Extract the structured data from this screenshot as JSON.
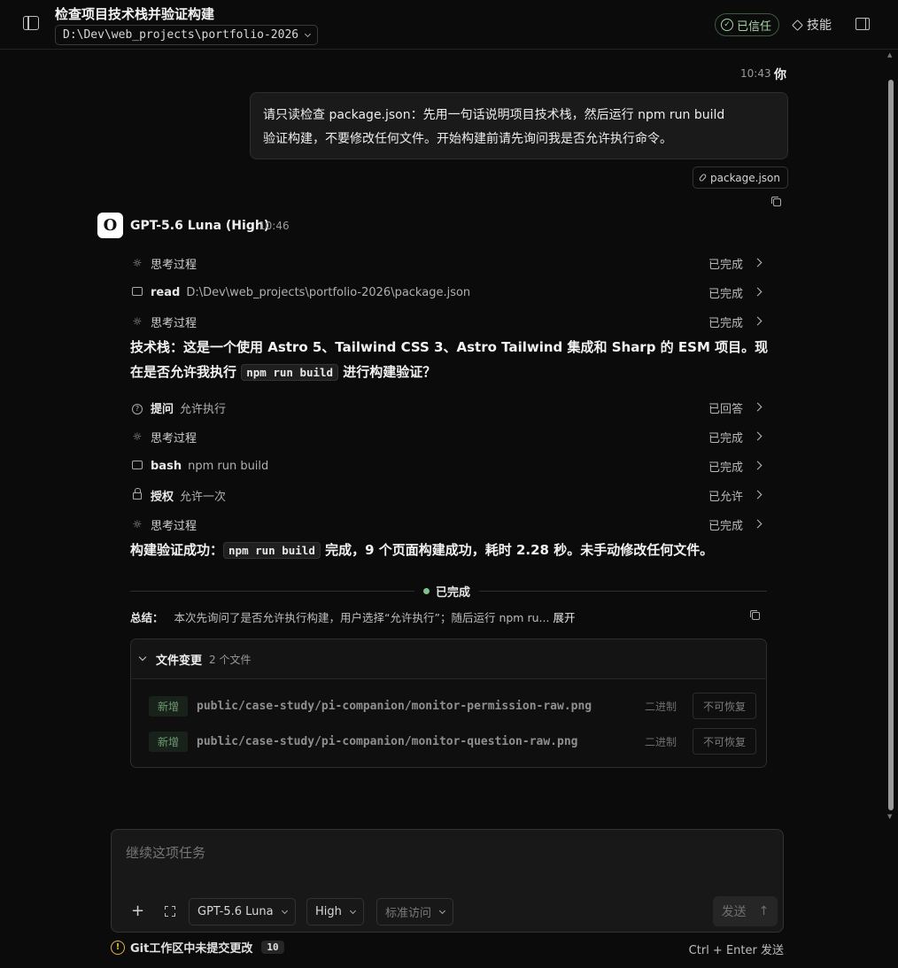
{
  "header": {
    "title": "检查项目技术栈并验证构建",
    "project_path": "D:\\Dev\\web_projects\\portfolio-2026",
    "trusted_label": "已信任",
    "skills_label": "技能"
  },
  "user_message": {
    "time": "10:43",
    "author": "你",
    "text_line1": "请只读检查 package.json：先用一句话说明项目技术栈，然后运行 npm run build",
    "text_line2": "验证构建，不要修改任何文件。开始构建前请先询问我是否允许执行命令。",
    "attachment": "package.json"
  },
  "assistant": {
    "avatar_letter": "O",
    "model": "GPT-5.6 Luna (High)",
    "time": "10:46",
    "steps_a": [
      {
        "icon": "thinking-icon",
        "kind": "思考过程",
        "detail": "",
        "status": "已完成"
      },
      {
        "icon": "terminal-icon",
        "kind": "read",
        "detail": "D:\\Dev\\web_projects\\portfolio-2026\\package.json",
        "status": "已完成"
      },
      {
        "icon": "thinking-icon",
        "kind": "思考过程",
        "detail": "",
        "status": "已完成"
      }
    ],
    "answer1_pre": "技术栈：这是一个使用 Astro 5、Tailwind CSS 3、Astro Tailwind 集成和 Sharp 的 ESM 项目。现在是否允许我执行 ",
    "answer1_code": "npm run build",
    "answer1_post": " 进行构建验证？",
    "steps_b": [
      {
        "icon": "question-icon",
        "kind": "提问",
        "detail": "允许执行",
        "status": "已回答"
      },
      {
        "icon": "thinking-icon",
        "kind": "思考过程",
        "detail": "",
        "status": "已完成"
      },
      {
        "icon": "terminal-icon",
        "kind": "bash",
        "detail": "npm run build",
        "status": "已完成"
      },
      {
        "icon": "lock-icon",
        "kind": "授权",
        "detail": "允许一次",
        "status": "已允许"
      },
      {
        "icon": "thinking-icon",
        "kind": "思考过程",
        "detail": "",
        "status": "已完成"
      }
    ],
    "answer2_pre": "构建验证成功：",
    "answer2_code": "npm run build",
    "answer2_post": " 完成，9 个页面构建成功，耗时 2.28 秒。未手动修改任何文件。",
    "done_label": "已完成",
    "summary_label": "总结：",
    "summary_text": "本次先询问了是否允许执行构建，用户选择“允许执行”；随后运行 npm ru...",
    "summary_expand": "展开"
  },
  "file_changes": {
    "title": "文件变更",
    "count": "2 个文件",
    "files": [
      {
        "badge": "新增",
        "path": "public/case-study/pi-companion/monitor-permission-raw.png",
        "kind": "二进制",
        "action": "不可恢复"
      },
      {
        "badge": "新增",
        "path": "public/case-study/pi-companion/monitor-question-raw.png",
        "kind": "二进制",
        "action": "不可恢复"
      }
    ]
  },
  "composer": {
    "placeholder": "继续这项任务",
    "model_select": "GPT-5.6 Luna",
    "effort_select": "High",
    "access_select": "标准访问",
    "send_label": "发送",
    "send_arrow": "↑"
  },
  "footer": {
    "git_warning": "Git工作区中未提交更改",
    "git_count": "10",
    "hint": "Ctrl + Enter 发送"
  },
  "colors": {
    "background": "#0b0b0b",
    "trusted_green": "#a5d6a7",
    "done_dot": "#7cc48a",
    "warning": "#e3b341"
  }
}
